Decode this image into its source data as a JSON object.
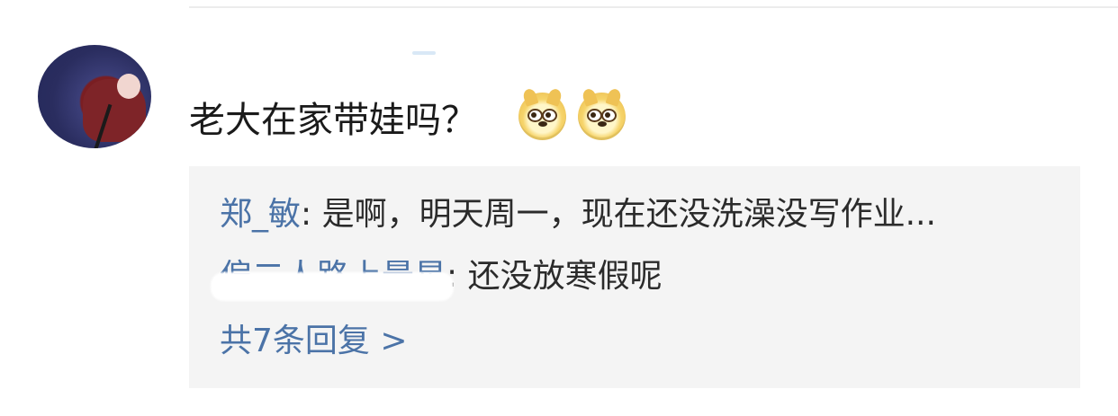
{
  "comment": {
    "text": "老大在家带娃吗？"
  },
  "replies": [
    {
      "author": "郑_敏",
      "text": ": 是啊，明天周一，现在还没洗澡没写作业..."
    },
    {
      "author": "偏二人路上最星",
      "text": ": 还没放寒假呢"
    }
  ],
  "more_replies": {
    "label": "共7条回复 >"
  },
  "emojis": [
    "doge-emoji",
    "doge-emoji"
  ],
  "colors": {
    "author_link": "#4b73a7",
    "reply_bg": "#f4f4f4",
    "text": "#1a1a1a"
  }
}
